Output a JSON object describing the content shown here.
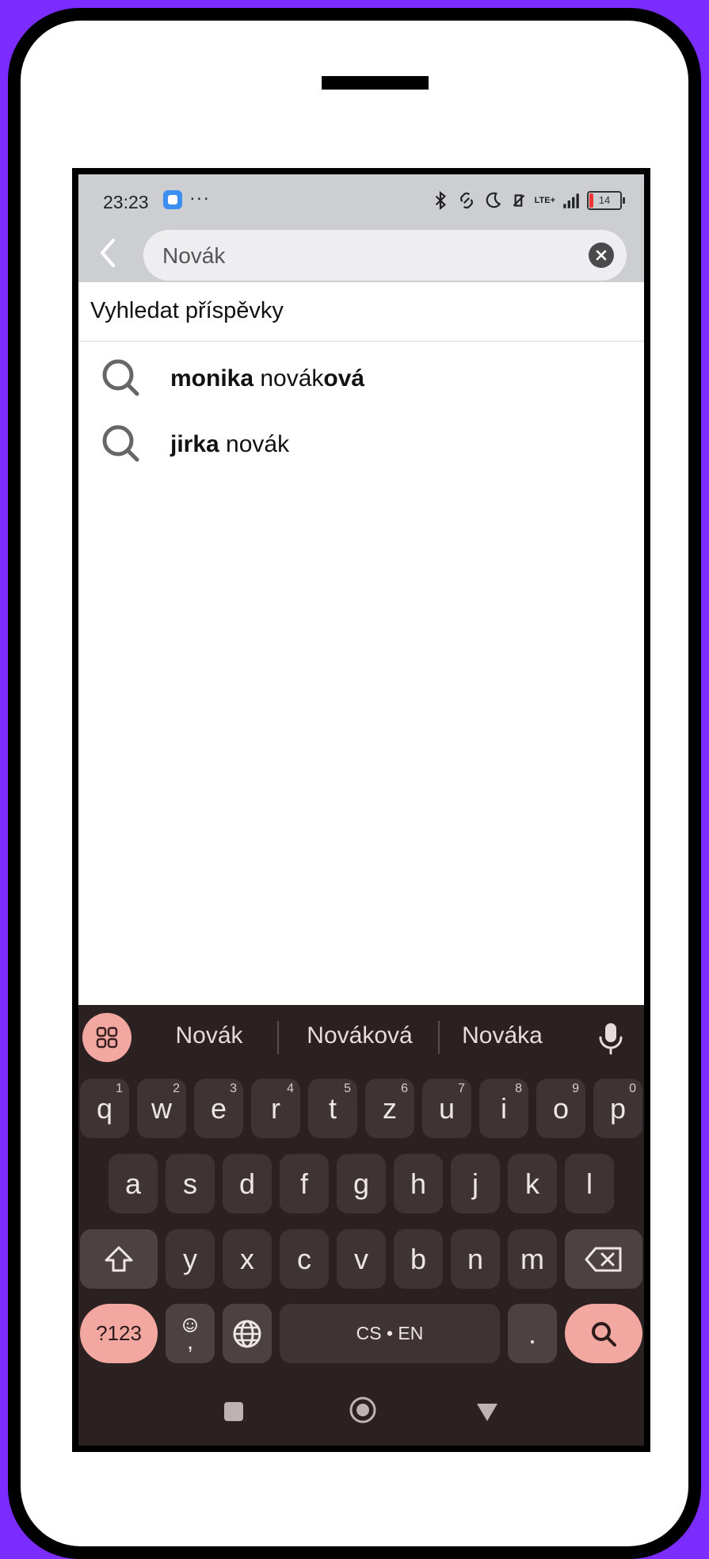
{
  "status_bar": {
    "time": "23:23",
    "dots": "···",
    "battery": "14",
    "network": "LTE+"
  },
  "search": {
    "value": "Novák"
  },
  "section": {
    "title": "Vyhledat příspěvky"
  },
  "suggestions": [
    {
      "bold_prefix": "monika",
      "plain": " novák",
      "bold_suffix": "ová"
    },
    {
      "bold_prefix": "jirka",
      "plain": " novák",
      "bold_suffix": ""
    }
  ],
  "keyboard": {
    "word_suggestions": [
      "Novák",
      "Nováková",
      "Nováka"
    ],
    "row1": [
      {
        "k": "q",
        "n": "1"
      },
      {
        "k": "w",
        "n": "2"
      },
      {
        "k": "e",
        "n": "3"
      },
      {
        "k": "r",
        "n": "4"
      },
      {
        "k": "t",
        "n": "5"
      },
      {
        "k": "z",
        "n": "6"
      },
      {
        "k": "u",
        "n": "7"
      },
      {
        "k": "i",
        "n": "8"
      },
      {
        "k": "o",
        "n": "9"
      },
      {
        "k": "p",
        "n": "0"
      }
    ],
    "row2": [
      "a",
      "s",
      "d",
      "f",
      "g",
      "h",
      "j",
      "k",
      "l"
    ],
    "row3": [
      "y",
      "x",
      "c",
      "v",
      "b",
      "n",
      "m"
    ],
    "symbols_label": "?123",
    "comma_label": ",",
    "space_label": "CS • EN",
    "period_label": ".",
    "accent_color": "#f3a7a1",
    "background_color": "#2b2121"
  },
  "icons": {
    "back": "chevron-left-icon",
    "clear": "close-icon",
    "suggestion": "search-icon",
    "apps": "grid-icon",
    "mic": "microphone-icon",
    "shift": "shift-icon",
    "backspace": "backspace-icon",
    "emoji": "emoji-icon",
    "globe": "globe-icon",
    "search_key": "search-icon"
  }
}
